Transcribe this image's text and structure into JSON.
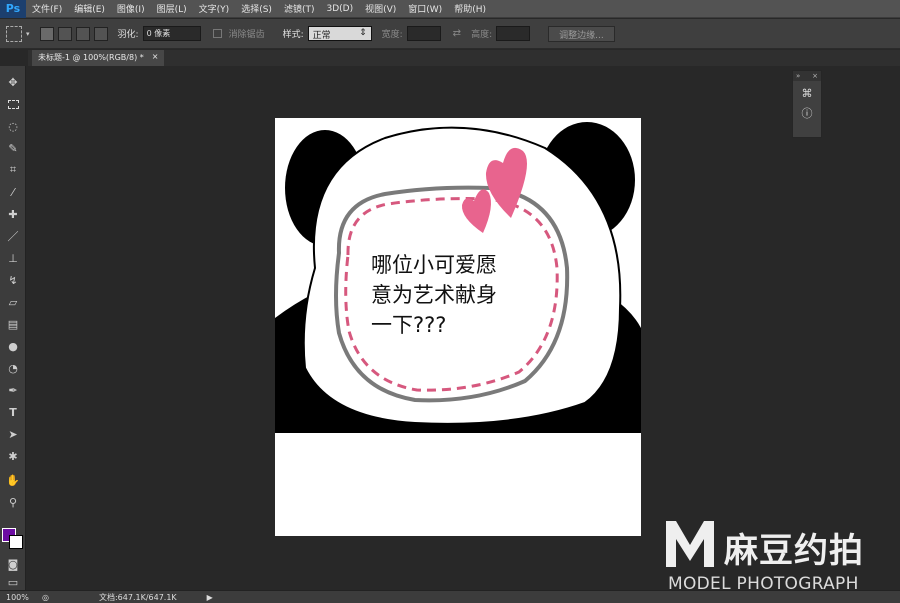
{
  "app": {
    "logo": "Ps"
  },
  "menu": [
    "文件(F)",
    "编辑(E)",
    "图像(I)",
    "图层(L)",
    "文字(Y)",
    "选择(S)",
    "滤镜(T)",
    "3D(D)",
    "视图(V)",
    "窗口(W)",
    "帮助(H)"
  ],
  "options": {
    "feather_label": "羽化:",
    "feather_value": "0 像素",
    "antialias_label": "消除锯齿",
    "style_label": "样式:",
    "style_value": "正常",
    "width_label": "宽度:",
    "height_label": "高度:",
    "adjust_button": "调整边缘..."
  },
  "tab": {
    "title": "未标题-1 @ 100%(RGB/8) *",
    "close": "×"
  },
  "canvas": {
    "text_lines": [
      "哪位小可爱愿",
      "意为艺术献身",
      "一下???"
    ],
    "colors": {
      "heart": "#e8648e",
      "dash": "#d6587e",
      "outline": "#7a7a7a"
    }
  },
  "panel": {
    "collapse": "»",
    "close": "×"
  },
  "colors": {
    "foreground": "#6c0da2",
    "background": "#ffffff"
  },
  "status": {
    "zoom": "100%",
    "doc_size": "文档:647.1K/647.1K"
  },
  "watermark": {
    "cn": "麻豆约拍",
    "en": "MODEL PHOTOGRAPH"
  }
}
